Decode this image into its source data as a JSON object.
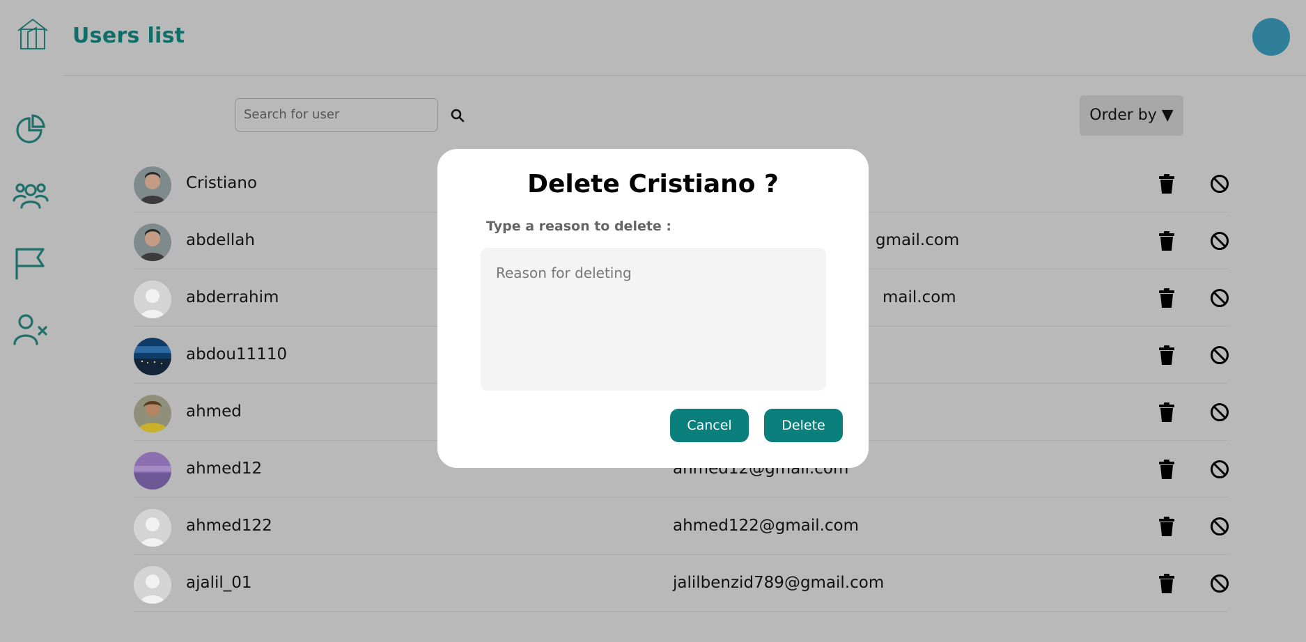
{
  "header": {
    "title": "Users list",
    "logo_icon": "house-icon",
    "avatar_color": "#2f7f9a"
  },
  "sidebar": {
    "items": [
      {
        "icon": "pie-chart-icon"
      },
      {
        "icon": "users-icon"
      },
      {
        "icon": "flag-icon"
      },
      {
        "icon": "user-remove-icon"
      }
    ]
  },
  "search": {
    "placeholder": "Search for user"
  },
  "order": {
    "label": "Order by ▼"
  },
  "users": [
    {
      "name": "Cristiano",
      "email": "",
      "avatar": "photo-man"
    },
    {
      "name": "abdellah",
      "email": "gmail.com",
      "avatar": "photo-man"
    },
    {
      "name": "abderrahim",
      "email": "mail.com",
      "avatar": "placeholder"
    },
    {
      "name": "abdou11110",
      "email": "",
      "avatar": "photo-night"
    },
    {
      "name": "ahmed",
      "email": "",
      "avatar": "photo-yellow"
    },
    {
      "name": "ahmed12",
      "email": "ahmed12@gmail.com",
      "avatar": "photo-purple"
    },
    {
      "name": "ahmed122",
      "email": "ahmed122@gmail.com",
      "avatar": "placeholder"
    },
    {
      "name": "ajalil_01",
      "email": "jalilbenzid789@gmail.com",
      "avatar": "placeholder"
    }
  ],
  "modal": {
    "title": "Delete Cristiano ?",
    "label": "Type a reason to delete :",
    "placeholder": "Reason for deleting",
    "cancel": "Cancel",
    "delete": "Delete"
  },
  "colors": {
    "accent": "#0b7f7c",
    "overlay_bg": "#b9b9b9",
    "title": "#0f6f68"
  }
}
